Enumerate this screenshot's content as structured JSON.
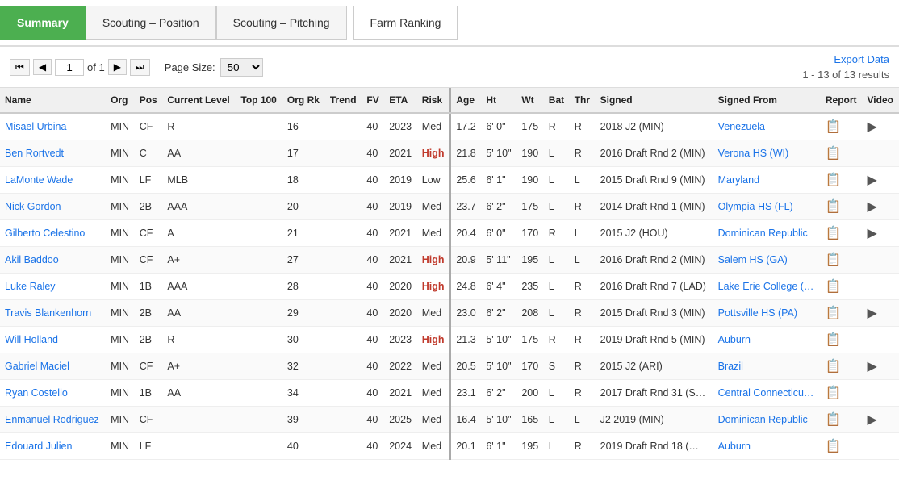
{
  "tabs": [
    {
      "id": "summary",
      "label": "Summary",
      "active": true
    },
    {
      "id": "scouting-position",
      "label": "Scouting – Position",
      "active": false
    },
    {
      "id": "scouting-pitching",
      "label": "Scouting – Pitching",
      "active": false
    },
    {
      "id": "farm-ranking",
      "label": "Farm Ranking",
      "active": false
    }
  ],
  "pagination": {
    "current_page": "1",
    "of_label": "of 1",
    "page_size": "50",
    "export_label": "Export Data",
    "results_label": "1 - 13 of 13 results"
  },
  "table": {
    "columns": [
      "Name",
      "Org",
      "Pos",
      "Current Level",
      "Top 100",
      "Org Rk",
      "Trend",
      "FV",
      "ETA",
      "Risk",
      "Age",
      "Ht",
      "Wt",
      "Bat",
      "Thr",
      "Signed",
      "Signed From",
      "Report",
      "Video"
    ],
    "rows": [
      {
        "name": "Misael Urbina",
        "org": "MIN",
        "pos": "CF",
        "level": "R",
        "top100": "",
        "org_rk": "16",
        "trend": "",
        "fv": "40",
        "eta": "2023",
        "risk": "Med",
        "age": "17.2",
        "ht": "6' 0\"",
        "wt": "175",
        "bat": "R",
        "thr": "R",
        "signed": "2018 J2 (MIN)",
        "signed_from": "Venezuela",
        "report": true,
        "video": true
      },
      {
        "name": "Ben Rortvedt",
        "org": "MIN",
        "pos": "C",
        "level": "AA",
        "top100": "",
        "org_rk": "17",
        "trend": "",
        "fv": "40",
        "eta": "2021",
        "risk": "High",
        "age": "21.8",
        "ht": "5' 10\"",
        "wt": "190",
        "bat": "L",
        "thr": "R",
        "signed": "2016 Draft Rnd 2 (MIN)",
        "signed_from": "Verona HS (WI)",
        "report": true,
        "video": false
      },
      {
        "name": "LaMonte Wade",
        "org": "MIN",
        "pos": "LF",
        "level": "MLB",
        "top100": "",
        "org_rk": "18",
        "trend": "",
        "fv": "40",
        "eta": "2019",
        "risk": "Low",
        "age": "25.6",
        "ht": "6' 1\"",
        "wt": "190",
        "bat": "L",
        "thr": "L",
        "signed": "2015 Draft Rnd 9 (MIN)",
        "signed_from": "Maryland",
        "report": true,
        "video": true
      },
      {
        "name": "Nick Gordon",
        "org": "MIN",
        "pos": "2B",
        "level": "AAA",
        "top100": "",
        "org_rk": "20",
        "trend": "",
        "fv": "40",
        "eta": "2019",
        "risk": "Med",
        "age": "23.7",
        "ht": "6' 2\"",
        "wt": "175",
        "bat": "L",
        "thr": "R",
        "signed": "2014 Draft Rnd 1 (MIN)",
        "signed_from": "Olympia HS (FL)",
        "report": true,
        "video": true
      },
      {
        "name": "Gilberto Celestino",
        "org": "MIN",
        "pos": "CF",
        "level": "A",
        "top100": "",
        "org_rk": "21",
        "trend": "",
        "fv": "40",
        "eta": "2021",
        "risk": "Med",
        "age": "20.4",
        "ht": "6' 0\"",
        "wt": "170",
        "bat": "R",
        "thr": "L",
        "signed": "2015 J2 (HOU)",
        "signed_from": "Dominican Republic",
        "report": true,
        "video": true
      },
      {
        "name": "Akil Baddoo",
        "org": "MIN",
        "pos": "CF",
        "level": "A+",
        "top100": "",
        "org_rk": "27",
        "trend": "",
        "fv": "40",
        "eta": "2021",
        "risk": "High",
        "age": "20.9",
        "ht": "5' 11\"",
        "wt": "195",
        "bat": "L",
        "thr": "L",
        "signed": "2016 Draft Rnd 2 (MIN)",
        "signed_from": "Salem HS (GA)",
        "report": true,
        "video": false
      },
      {
        "name": "Luke Raley",
        "org": "MIN",
        "pos": "1B",
        "level": "AAA",
        "top100": "",
        "org_rk": "28",
        "trend": "",
        "fv": "40",
        "eta": "2020",
        "risk": "High",
        "age": "24.8",
        "ht": "6' 4\"",
        "wt": "235",
        "bat": "L",
        "thr": "R",
        "signed": "2016 Draft Rnd 7 (LAD)",
        "signed_from": "Lake Erie College (…",
        "report": true,
        "video": false
      },
      {
        "name": "Travis Blankenhorn",
        "org": "MIN",
        "pos": "2B",
        "level": "AA",
        "top100": "",
        "org_rk": "29",
        "trend": "",
        "fv": "40",
        "eta": "2020",
        "risk": "Med",
        "age": "23.0",
        "ht": "6' 2\"",
        "wt": "208",
        "bat": "L",
        "thr": "R",
        "signed": "2015 Draft Rnd 3 (MIN)",
        "signed_from": "Pottsville HS (PA)",
        "report": true,
        "video": true
      },
      {
        "name": "Will Holland",
        "org": "MIN",
        "pos": "2B",
        "level": "R",
        "top100": "",
        "org_rk": "30",
        "trend": "",
        "fv": "40",
        "eta": "2023",
        "risk": "High",
        "age": "21.3",
        "ht": "5' 10\"",
        "wt": "175",
        "bat": "R",
        "thr": "R",
        "signed": "2019 Draft Rnd 5 (MIN)",
        "signed_from": "Auburn",
        "report": true,
        "video": false
      },
      {
        "name": "Gabriel Maciel",
        "org": "MIN",
        "pos": "CF",
        "level": "A+",
        "top100": "",
        "org_rk": "32",
        "trend": "",
        "fv": "40",
        "eta": "2022",
        "risk": "Med",
        "age": "20.5",
        "ht": "5' 10\"",
        "wt": "170",
        "bat": "S",
        "thr": "R",
        "signed": "2015 J2 (ARI)",
        "signed_from": "Brazil",
        "report": true,
        "video": true
      },
      {
        "name": "Ryan Costello",
        "org": "MIN",
        "pos": "1B",
        "level": "AA",
        "top100": "",
        "org_rk": "34",
        "trend": "",
        "fv": "40",
        "eta": "2021",
        "risk": "Med",
        "age": "23.1",
        "ht": "6' 2\"",
        "wt": "200",
        "bat": "L",
        "thr": "R",
        "signed": "2017 Draft Rnd 31 (S…",
        "signed_from": "Central Connecticu…",
        "report": true,
        "video": false
      },
      {
        "name": "Enmanuel Rodriguez",
        "org": "MIN",
        "pos": "CF",
        "level": "",
        "top100": "",
        "org_rk": "39",
        "trend": "",
        "fv": "40",
        "eta": "2025",
        "risk": "Med",
        "age": "16.4",
        "ht": "5' 10\"",
        "wt": "165",
        "bat": "L",
        "thr": "L",
        "signed": "J2 2019 (MIN)",
        "signed_from": "Dominican Republic",
        "report": true,
        "video": true
      },
      {
        "name": "Edouard Julien",
        "org": "MIN",
        "pos": "LF",
        "level": "",
        "top100": "",
        "org_rk": "40",
        "trend": "",
        "fv": "40",
        "eta": "2024",
        "risk": "Med",
        "age": "20.1",
        "ht": "6' 1\"",
        "wt": "195",
        "bat": "L",
        "thr": "R",
        "signed": "2019 Draft Rnd 18 (…",
        "signed_from": "Auburn",
        "report": true,
        "video": false
      }
    ]
  },
  "icons": {
    "first_page": "⏮",
    "prev_page": "◀",
    "next_page": "▶",
    "last_page": "⏭",
    "report": "📋",
    "video": "▶"
  }
}
